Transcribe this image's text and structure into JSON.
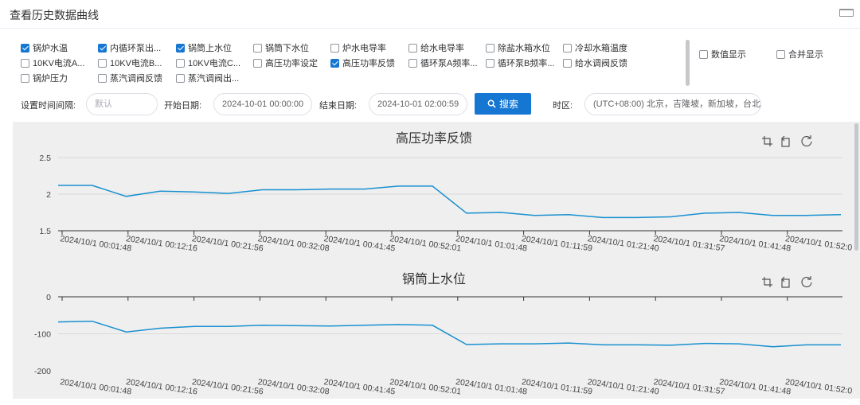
{
  "window": {
    "title": "查看历史数据曲线"
  },
  "checkboxes": [
    {
      "label": "锅炉水温",
      "checked": true
    },
    {
      "label": "内循环泵出...",
      "checked": true
    },
    {
      "label": "锅筒上水位",
      "checked": true
    },
    {
      "label": "锅筒下水位",
      "checked": false
    },
    {
      "label": "炉水电导率",
      "checked": false
    },
    {
      "label": "给水电导率",
      "checked": false
    },
    {
      "label": "除盐水箱水位",
      "checked": false
    },
    {
      "label": "冷却水箱温度",
      "checked": false
    },
    {
      "label": "10KV电流A...",
      "checked": false
    },
    {
      "label": "10KV电流B...",
      "checked": false
    },
    {
      "label": "10KV电流C...",
      "checked": false
    },
    {
      "label": "高压功率设定",
      "checked": false
    },
    {
      "label": "高压功率反馈",
      "checked": true
    },
    {
      "label": "循环泵A频率...",
      "checked": false
    },
    {
      "label": "循环泵B频率...",
      "checked": false
    },
    {
      "label": "给水调阀反馈",
      "checked": false
    },
    {
      "label": "锅炉压力",
      "checked": false
    },
    {
      "label": "蒸汽调阀反馈",
      "checked": false
    },
    {
      "label": "蒸汽调阀出...",
      "checked": false
    }
  ],
  "options": [
    {
      "label": "数值显示",
      "checked": false
    },
    {
      "label": "合并显示",
      "checked": false
    }
  ],
  "filters": {
    "interval_label": "设置时间间隔:",
    "interval_placeholder": "默认",
    "start_label": "开始日期:",
    "start_value": "2024-10-01 00:00:00",
    "end_label": "结束日期:",
    "end_value": "2024-10-01 02:00:59",
    "search_label": "搜索",
    "timezone_label": "时区:",
    "timezone_value": "(UTC+08:00) 北京，吉隆坡，新加坡，台北"
  },
  "chart_data": [
    {
      "type": "line",
      "title": "高压功率反馈",
      "ylim": [
        1.5,
        2.5
      ],
      "yticks": [
        "1.5",
        "2",
        "2.5"
      ],
      "grid": true,
      "xticks": [
        "2024/10/1 00:01:48",
        "2024/10/1 00:12:16",
        "2024/10/1 00:21:56",
        "2024/10/1 00:32:08",
        "2024/10/1 00:41:45",
        "2024/10/1 00:52:01",
        "2024/10/1 01:01:48",
        "2024/10/1 01:11:59",
        "2024/10/1 01:21:40",
        "2024/10/1 01:31:57",
        "2024/10/1 01:41:48",
        "2024/10/1 01:52:0"
      ],
      "series": [
        {
          "color": "#1890d0",
          "values": [
            2.12,
            2.12,
            1.97,
            2.04,
            2.03,
            2.01,
            2.06,
            2.06,
            2.07,
            2.07,
            2.11,
            2.11,
            1.74,
            1.75,
            1.71,
            1.72,
            1.68,
            1.68,
            1.69,
            1.74,
            1.75,
            1.71,
            1.71,
            1.72
          ]
        }
      ]
    },
    {
      "type": "line",
      "title": "锅筒上水位",
      "ylim": [
        -200,
        0
      ],
      "yticks": [
        "-200",
        "-100",
        "0"
      ],
      "grid": true,
      "xticks": [
        "2024/10/1 00:01:48",
        "2024/10/1 00:12:16",
        "2024/10/1 00:21:56",
        "2024/10/1 00:32:08",
        "2024/10/1 00:41:45",
        "2024/10/1 00:52:01",
        "2024/10/1 01:01:48",
        "2024/10/1 01:11:59",
        "2024/10/1 01:21:40",
        "2024/10/1 01:31:57",
        "2024/10/1 01:41:48",
        "2024/10/1 01:52:0"
      ],
      "series": [
        {
          "color": "#1890d0",
          "values": [
            -68,
            -66,
            -95,
            -85,
            -80,
            -80,
            -77,
            -78,
            -79,
            -77,
            -75,
            -77,
            -129,
            -127,
            -127,
            -125,
            -130,
            -130,
            -131,
            -126,
            -127,
            -135,
            -130,
            -130
          ]
        }
      ]
    }
  ]
}
